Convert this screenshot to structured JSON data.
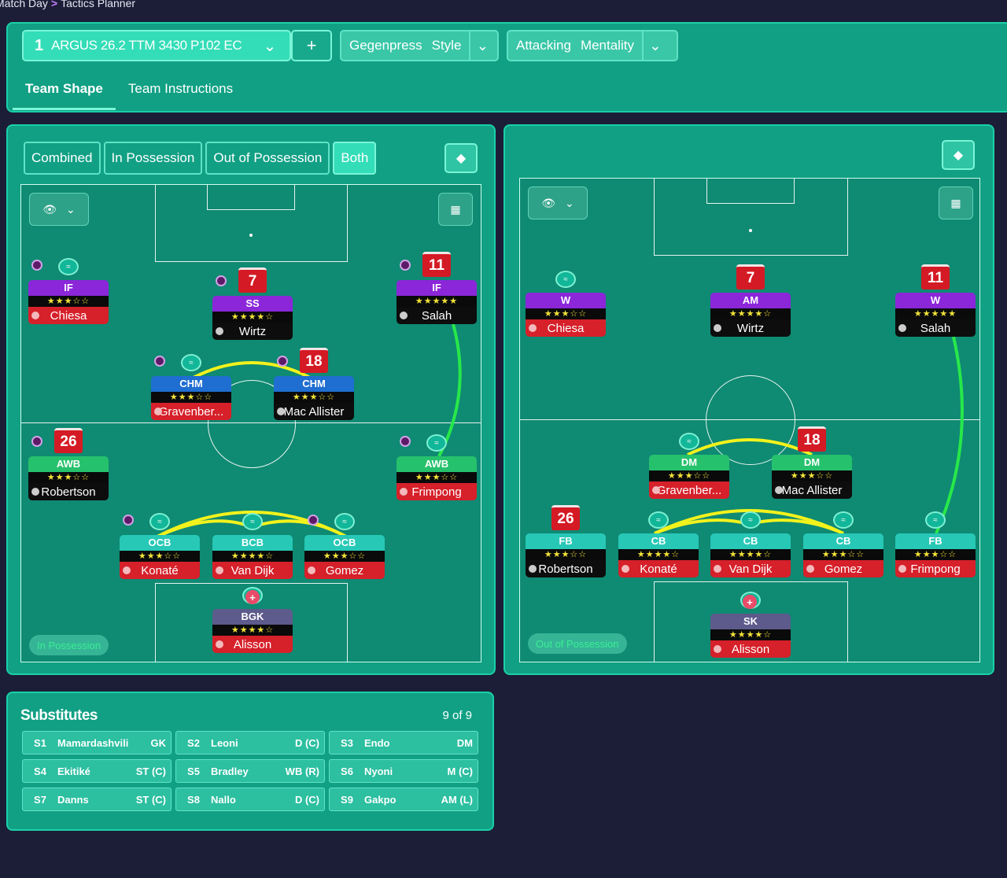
{
  "breadcrumb": {
    "parent": "Match Day",
    "current": "Tactics Planner"
  },
  "tactic": {
    "number": "1",
    "name": "ARGUS 26.2 TTM 3430 P102 EC",
    "add": "+"
  },
  "style": {
    "label": "Gegenpress",
    "value": "Style"
  },
  "mentality": {
    "label": "Attacking",
    "value": "Mentality"
  },
  "tabs": [
    {
      "label": "Team Shape"
    },
    {
      "label": "Team Instructions"
    }
  ],
  "view_modes": [
    "Combined",
    "In Possession",
    "Out of Possession",
    "Both"
  ],
  "left_pitch": {
    "badge": "In Possession",
    "players": [
      {
        "role": "IF",
        "stars": "★★★☆☆",
        "name": "Chiesa"
      },
      {
        "role": "SS",
        "stars": "★★★★☆",
        "name": "Wirtz",
        "shirt": "7"
      },
      {
        "role": "IF",
        "stars": "★★★★★",
        "name": "Salah",
        "shirt": "11"
      },
      {
        "role": "CHM",
        "stars": "★★★☆☆",
        "name": "Gravenber..."
      },
      {
        "role": "CHM",
        "stars": "★★★☆☆",
        "name": "Mac Allister",
        "shirt": "18"
      },
      {
        "role": "AWB",
        "stars": "★★★☆☆",
        "name": "Robertson",
        "shirt": "26"
      },
      {
        "role": "AWB",
        "stars": "★★★☆☆",
        "name": "Frimpong"
      },
      {
        "role": "OCB",
        "stars": "★★★☆☆",
        "name": "Konaté"
      },
      {
        "role": "BCB",
        "stars": "★★★★☆",
        "name": "Van Dijk"
      },
      {
        "role": "OCB",
        "stars": "★★★☆☆",
        "name": "Gomez"
      },
      {
        "role": "BGK",
        "stars": "★★★★☆",
        "name": "Alisson"
      }
    ]
  },
  "right_pitch": {
    "badge": "Out of Possession",
    "players": [
      {
        "role": "W",
        "stars": "★★★☆☆",
        "name": "Chiesa"
      },
      {
        "role": "AM",
        "stars": "★★★★☆",
        "name": "Wirtz",
        "shirt": "7"
      },
      {
        "role": "W",
        "stars": "★★★★★",
        "name": "Salah",
        "shirt": "11"
      },
      {
        "role": "DM",
        "stars": "★★★☆☆",
        "name": "Gravenber..."
      },
      {
        "role": "DM",
        "stars": "★★★☆☆",
        "name": "Mac Allister",
        "shirt": "18"
      },
      {
        "role": "FB",
        "stars": "★★★☆☆",
        "name": "Robertson",
        "shirt": "26"
      },
      {
        "role": "CB",
        "stars": "★★★★☆",
        "name": "Konaté"
      },
      {
        "role": "CB",
        "stars": "★★★★☆",
        "name": "Van Dijk"
      },
      {
        "role": "CB",
        "stars": "★★★☆☆",
        "name": "Gomez"
      },
      {
        "role": "FB",
        "stars": "★★★☆☆",
        "name": "Frimpong"
      },
      {
        "role": "SK",
        "stars": "★★★★☆",
        "name": "Alisson"
      }
    ]
  },
  "substitutes": {
    "title": "Substitutes",
    "count": "9 of 9",
    "list": [
      {
        "slot": "S1",
        "name": "Mamardashvili",
        "pos": "GK"
      },
      {
        "slot": "S2",
        "name": "Leoni",
        "pos": "D (C)"
      },
      {
        "slot": "S3",
        "name": "Endo",
        "pos": "DM"
      },
      {
        "slot": "S4",
        "name": "Ekitiké",
        "pos": "ST (C)"
      },
      {
        "slot": "S5",
        "name": "Bradley",
        "pos": "WB (R)"
      },
      {
        "slot": "S6",
        "name": "Nyoni",
        "pos": "M (C)"
      },
      {
        "slot": "S7",
        "name": "Danns",
        "pos": "ST (C)"
      },
      {
        "slot": "S8",
        "name": "Nallo",
        "pos": "D (C)"
      },
      {
        "slot": "S9",
        "name": "Gakpo",
        "pos": "AM (L)"
      }
    ]
  },
  "colors": {
    "panel": "#11a084",
    "pitch": "#0f8a73",
    "link_yellow": "#f2f21c",
    "link_green": "#27e84a"
  }
}
